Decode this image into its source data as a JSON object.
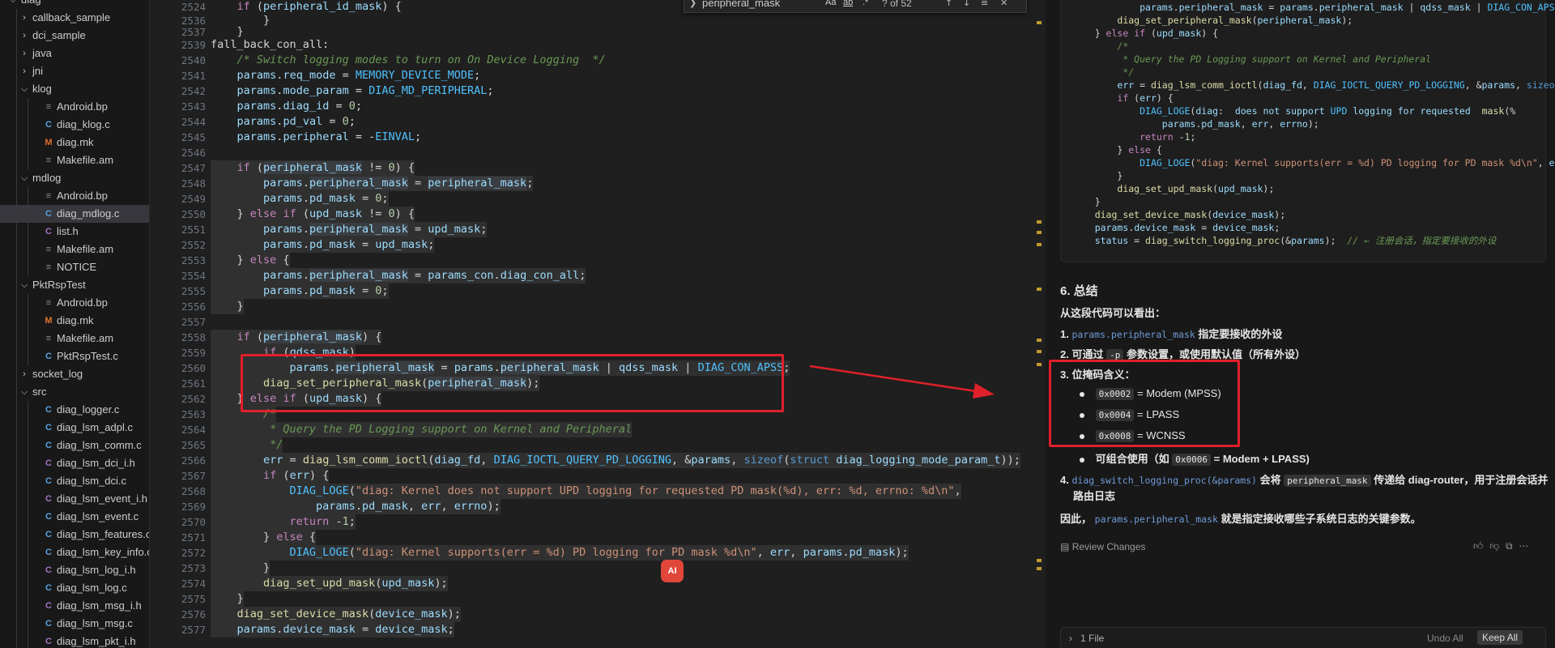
{
  "explorer": {
    "items": [
      {
        "label": "diag",
        "kind": "folder",
        "open": true,
        "indent": 0
      },
      {
        "label": "callback_sample",
        "kind": "folder",
        "open": false,
        "indent": 1
      },
      {
        "label": "dci_sample",
        "kind": "folder",
        "open": false,
        "indent": 1
      },
      {
        "label": "java",
        "kind": "folder",
        "open": false,
        "indent": 1
      },
      {
        "label": "jni",
        "kind": "folder",
        "open": false,
        "indent": 1
      },
      {
        "label": "klog",
        "kind": "folder",
        "open": true,
        "indent": 1
      },
      {
        "label": "Android.bp",
        "kind": "file",
        "icon": "lines",
        "indent": 2
      },
      {
        "label": "diag_klog.c",
        "kind": "file",
        "icon": "C",
        "indent": 2
      },
      {
        "label": "diag.mk",
        "kind": "file",
        "icon": "M",
        "indent": 2
      },
      {
        "label": "Makefile.am",
        "kind": "file",
        "icon": "lines",
        "indent": 2
      },
      {
        "label": "mdlog",
        "kind": "folder",
        "open": true,
        "indent": 1
      },
      {
        "label": "Android.bp",
        "kind": "file",
        "icon": "lines",
        "indent": 2
      },
      {
        "label": "diag_mdlog.c",
        "kind": "file",
        "icon": "C",
        "indent": 2,
        "selected": true
      },
      {
        "label": "list.h",
        "kind": "file",
        "icon": "C-purple",
        "indent": 2
      },
      {
        "label": "Makefile.am",
        "kind": "file",
        "icon": "lines",
        "indent": 2
      },
      {
        "label": "NOTICE",
        "kind": "file",
        "icon": "lines",
        "indent": 2
      },
      {
        "label": "PktRspTest",
        "kind": "folder",
        "open": true,
        "indent": 1
      },
      {
        "label": "Android.bp",
        "kind": "file",
        "icon": "lines",
        "indent": 2
      },
      {
        "label": "diag.mk",
        "kind": "file",
        "icon": "M",
        "indent": 2
      },
      {
        "label": "Makefile.am",
        "kind": "file",
        "icon": "lines",
        "indent": 2
      },
      {
        "label": "PktRspTest.c",
        "kind": "file",
        "icon": "C",
        "indent": 2
      },
      {
        "label": "socket_log",
        "kind": "folder",
        "open": false,
        "indent": 1
      },
      {
        "label": "src",
        "kind": "folder",
        "open": true,
        "indent": 1
      },
      {
        "label": "diag_logger.c",
        "kind": "file",
        "icon": "C",
        "indent": 2
      },
      {
        "label": "diag_lsm_adpl.c",
        "kind": "file",
        "icon": "C",
        "indent": 2
      },
      {
        "label": "diag_lsm_comm.c",
        "kind": "file",
        "icon": "C",
        "indent": 2
      },
      {
        "label": "diag_lsm_dci_i.h",
        "kind": "file",
        "icon": "C-purple",
        "indent": 2
      },
      {
        "label": "diag_lsm_dci.c",
        "kind": "file",
        "icon": "C",
        "indent": 2
      },
      {
        "label": "diag_lsm_event_i.h",
        "kind": "file",
        "icon": "C-purple",
        "indent": 2
      },
      {
        "label": "diag_lsm_event.c",
        "kind": "file",
        "icon": "C",
        "indent": 2
      },
      {
        "label": "diag_lsm_features.c",
        "kind": "file",
        "icon": "C",
        "indent": 2
      },
      {
        "label": "diag_lsm_key_info.c",
        "kind": "file",
        "icon": "C",
        "indent": 2
      },
      {
        "label": "diag_lsm_log_i.h",
        "kind": "file",
        "icon": "C-purple",
        "indent": 2
      },
      {
        "label": "diag_lsm_log.c",
        "kind": "file",
        "icon": "C",
        "indent": 2
      },
      {
        "label": "diag_lsm_msg_i.h",
        "kind": "file",
        "icon": "C-purple",
        "indent": 2
      },
      {
        "label": "diag_lsm_msg.c",
        "kind": "file",
        "icon": "C",
        "indent": 2
      },
      {
        "label": "diag_lsm_pkt_i.h",
        "kind": "file",
        "icon": "C-purple",
        "indent": 2
      }
    ]
  },
  "find_widget": {
    "query": "peripheral_mask",
    "count": "? of 52",
    "opt_case": "Aa",
    "opt_word": "ab",
    "opt_regex": ".*"
  },
  "editor": {
    "lines": [
      {
        "n": "2524",
        "t": "    if (peripheral_id_mask) {"
      },
      {
        "n": "2536",
        "t": "        }"
      },
      {
        "n": "2537",
        "t": "    }"
      },
      {
        "n": "2539",
        "t": "fall_back_con_all:"
      },
      {
        "n": "2540",
        "t": "    /* Switch logging modes to turn on On Device Logging  */"
      },
      {
        "n": "2541",
        "t": "    params.req_mode = MEMORY_DEVICE_MODE;"
      },
      {
        "n": "2542",
        "t": "    params.mode_param = DIAG_MD_PERIPHERAL;"
      },
      {
        "n": "2543",
        "t": "    params.diag_id = 0;"
      },
      {
        "n": "2544",
        "t": "    params.pd_val = 0;"
      },
      {
        "n": "2545",
        "t": "    params.peripheral = -EINVAL;"
      },
      {
        "n": "2546",
        "t": ""
      },
      {
        "n": "2547",
        "t": "    if (peripheral_mask != 0) {"
      },
      {
        "n": "2548",
        "t": "        params.peripheral_mask = peripheral_mask;"
      },
      {
        "n": "2549",
        "t": "        params.pd_mask = 0;"
      },
      {
        "n": "2550",
        "t": "    } else if (upd_mask != 0) {"
      },
      {
        "n": "2551",
        "t": "        params.peripheral_mask = upd_mask;"
      },
      {
        "n": "2552",
        "t": "        params.pd_mask = upd_mask;"
      },
      {
        "n": "2553",
        "t": "    } else {"
      },
      {
        "n": "2554",
        "t": "        params.peripheral_mask = params_con.diag_con_all;"
      },
      {
        "n": "2555",
        "t": "        params.pd_mask = 0;"
      },
      {
        "n": "2556",
        "t": "    }"
      },
      {
        "n": "2557",
        "t": ""
      },
      {
        "n": "2558",
        "t": "    if (peripheral_mask) {"
      },
      {
        "n": "2559",
        "t": "        if (qdss_mask)"
      },
      {
        "n": "2560",
        "t": "            params.peripheral_mask = params.peripheral_mask | qdss_mask | DIAG_CON_APSS;"
      },
      {
        "n": "2561",
        "t": "        diag_set_peripheral_mask(peripheral_mask);"
      },
      {
        "n": "2562",
        "t": "    } else if (upd_mask) {"
      },
      {
        "n": "2563",
        "t": "        /*"
      },
      {
        "n": "2564",
        "t": "         * Query the PD Logging support on Kernel and Peripheral"
      },
      {
        "n": "2565",
        "t": "         */"
      },
      {
        "n": "2566",
        "t": "        err = diag_lsm_comm_ioctl(diag_fd, DIAG_IOCTL_QUERY_PD_LOGGING, &params, sizeof(struct diag_logging_mode_param_t));"
      },
      {
        "n": "2567",
        "t": "        if (err) {"
      },
      {
        "n": "2568",
        "t": "            DIAG_LOGE(\"diag: Kernel does not support UPD logging for requested PD mask(%d), err: %d, errno: %d\\n\","
      },
      {
        "n": "2569",
        "t": "                params.pd_mask, err, errno);"
      },
      {
        "n": "2570",
        "t": "            return -1;"
      },
      {
        "n": "2571",
        "t": "        } else {"
      },
      {
        "n": "2572",
        "t": "            DIAG_LOGE(\"diag: Kernel supports(err = %d) PD logging for PD mask %d\\n\", err, params.pd_mask);"
      },
      {
        "n": "2573",
        "t": "        }"
      },
      {
        "n": "2574",
        "t": "        diag_set_upd_mask(upd_mask);"
      },
      {
        "n": "2575",
        "t": "    }"
      },
      {
        "n": "2576",
        "t": "    diag_set_device_mask(device_mask);"
      },
      {
        "n": "2577",
        "t": "    params.device_mask = device_mask;"
      }
    ]
  },
  "chat": {
    "code": [
      "            params.peripheral_mask = params.peripheral_mask | qdss_mask | DIAG_CON_APSS;",
      "        diag_set_peripheral_mask(peripheral_mask);",
      "    } else if (upd_mask) {",
      "        /*",
      "         * Query the PD Logging support on Kernel and Peripheral",
      "         */",
      "        err = diag_lsm_comm_ioctl(diag_fd, DIAG_IOCTL_QUERY_PD_LOGGING, &params, sizeof(",
      "        if (err) {",
      "            DIAG_LOGE(\"diag: Kernel does not support UPD logging for requested PD mask(%",
      "                params.pd_mask, err, errno);",
      "            return -1;",
      "        } else {",
      "            DIAG_LOGE(\"diag: Kernel supports(err = %d) PD logging for PD mask %d\\n\", err",
      "        }",
      "        diag_set_upd_mask(upd_mask);",
      "    }",
      "    diag_set_device_mask(device_mask);",
      "    params.device_mask = device_mask;",
      "    status = diag_switch_logging_proc(&params);  // ← 注册会话，指定要接收的外设"
    ],
    "summary": {
      "heading": "6. 总结",
      "intro": "从这段代码可以看出：",
      "p1_num": "1.",
      "p1_code": "params.peripheral_mask",
      "p1_text": "指定要接收的外设",
      "p2_num": "2.",
      "p2_a": "可通过",
      "p2_chip": "-p",
      "p2_b": "参数设置，或使用默认值（所有外设）",
      "p3_num": "3.",
      "p3_text": "位掩码含义：",
      "masks": [
        {
          "code": "0x0002",
          "desc": "= Modem (MPSS)"
        },
        {
          "code": "0x0004",
          "desc": "= LPASS"
        },
        {
          "code": "0x0008",
          "desc": "= WCNSS"
        }
      ],
      "combine_a": "可组合使用（如",
      "combine_chip": "0x0006",
      "combine_b": "= Modem + LPASS)",
      "p4_num": "4.",
      "p4_code": "diag_switch_logging_proc(&params)",
      "p4_a": "会将",
      "p4_chip": "peripheral_mask",
      "p4_b": "传递给 diag-router，用于注册会话并",
      "p4_c": "路由日志",
      "conclusion_a": "因此，",
      "conclusion_code": "params.peripheral_mask",
      "conclusion_b": "就是指定接收哪些子系统日志的关键参数。"
    },
    "review_label": "Review Changes",
    "files_label": "1 File",
    "undo_all": "Undo All",
    "keep_all": "Keep All"
  },
  "ai_badge": "AI",
  "colors": {
    "annotation_red": "#e0202a",
    "selected": "#37373d"
  }
}
